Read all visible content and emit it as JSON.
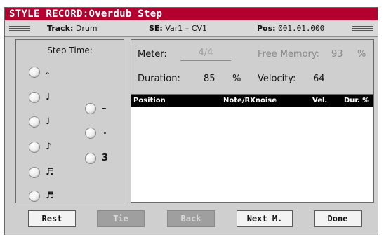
{
  "title": "STYLE RECORD:Overdub Step",
  "info": {
    "track_label": "Track:",
    "track_value": "Drum",
    "se_label": "SE:",
    "se_value": "Var1 – CV1",
    "pos_label": "Pos:",
    "pos_value": "001.01.000"
  },
  "step_time": {
    "title": "Step Time:",
    "col1": [
      {
        "glyph": "𝅝",
        "selected": true
      },
      {
        "glyph": "♩",
        "selected": false
      },
      {
        "glyph": "♩",
        "selected": false
      },
      {
        "glyph": "♪",
        "selected": false
      },
      {
        "glyph": "♬",
        "selected": false
      },
      {
        "glyph": "♬",
        "selected": false
      }
    ],
    "col2": [
      {
        "glyph": "–",
        "selected": true
      },
      {
        "glyph": ".",
        "selected": false
      },
      {
        "glyph": "3",
        "selected": false
      }
    ]
  },
  "params": {
    "meter_label": "Meter:",
    "meter_value": "4/4",
    "free_memory_label": "Free Memory:",
    "free_memory_value": "93",
    "free_memory_unit": "%",
    "duration_label": "Duration:",
    "duration_value": "85",
    "duration_unit": "%",
    "velocity_label": "Velocity:",
    "velocity_value": "64"
  },
  "list": {
    "headers": [
      "Position",
      "Note/RXnoise",
      "Vel.",
      "Dur. %"
    ]
  },
  "buttons": [
    {
      "label": "Rest",
      "enabled": true
    },
    {
      "label": "Tie",
      "enabled": false
    },
    {
      "label": "Back",
      "enabled": false
    },
    {
      "label": "Next M.",
      "enabled": true
    },
    {
      "label": "Done",
      "enabled": true
    }
  ],
  "colors": {
    "title_bar": "#b4002e",
    "radio_selected": "#b4002e",
    "panel_bg": "#cfcfcf"
  }
}
